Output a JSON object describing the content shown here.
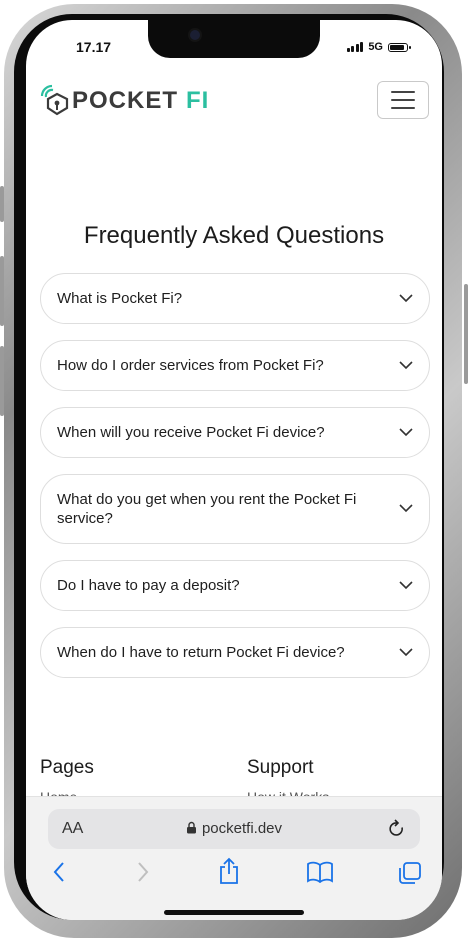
{
  "status_bar": {
    "time": "17.17",
    "network": "5G"
  },
  "header": {
    "logo_main": "POCKET",
    "logo_accent": "FI"
  },
  "faq": {
    "title": "Frequently Asked Questions",
    "questions": [
      "What is Pocket Fi?",
      "How do I order services from Pocket Fi?",
      "When will you receive Pocket Fi device?",
      "What do you get when you rent the Pocket Fi service?",
      "Do I have to pay a deposit?",
      "When do I have to return Pocket Fi device?"
    ]
  },
  "footer": {
    "pages_heading": "Pages",
    "pages_first_link": "Home",
    "support_heading": "Support",
    "support_first_link": "How it Works"
  },
  "browser": {
    "text_size_label": "AA",
    "url": "pocketfi.dev",
    "accent_color": "#1a73e8"
  },
  "colors": {
    "brand_green": "#2bbfa0",
    "text_dark": "#1c1c1c"
  }
}
